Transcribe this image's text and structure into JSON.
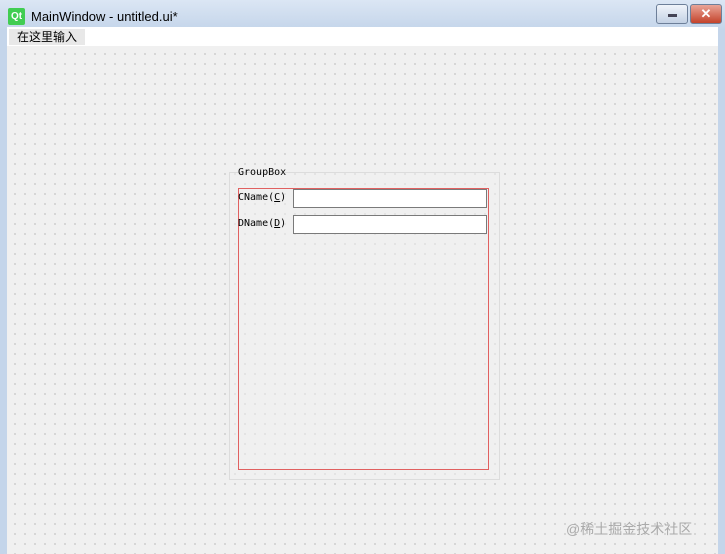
{
  "window": {
    "title": "MainWindow - untitled.ui*",
    "logo": "Qt",
    "close_glyph": "✕"
  },
  "menubar": {
    "placeholder": "在这里输入"
  },
  "groupbox": {
    "title": "GroupBox",
    "fields": [
      {
        "label_pre": "CName(",
        "mnemonic": "C",
        "label_post": ")",
        "value": ""
      },
      {
        "label_pre": "DName(",
        "mnemonic": "D",
        "label_post": ")",
        "value": ""
      }
    ]
  },
  "watermark": "@稀土掘金技术社区"
}
